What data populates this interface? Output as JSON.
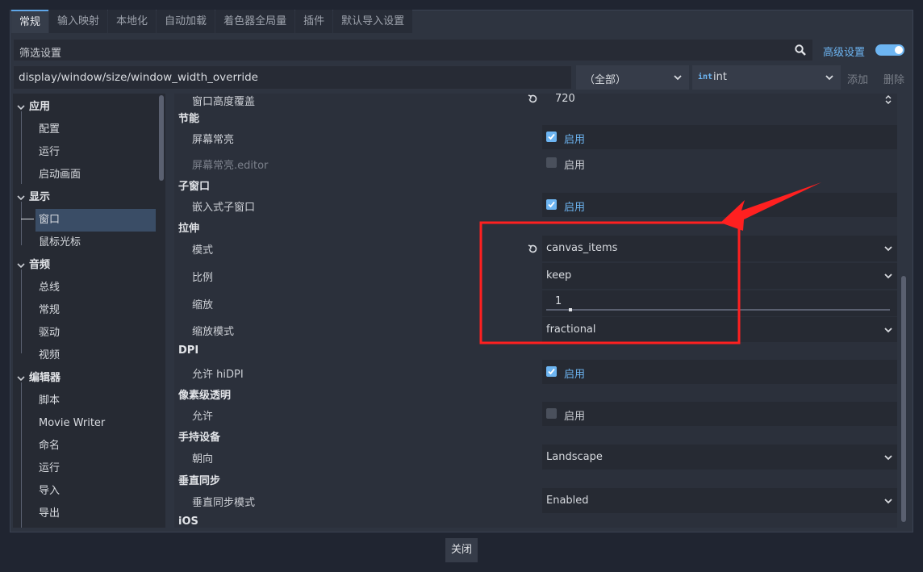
{
  "tabs": [
    "常规",
    "输入映射",
    "本地化",
    "自动加载",
    "着色器全局量",
    "插件",
    "默认导入设置"
  ],
  "filter": {
    "placeholder": "筛选设置"
  },
  "advanced": {
    "label": "高级设置",
    "enabled": true
  },
  "path": {
    "value": "display/window/size/window_width_override"
  },
  "category_dropdown": {
    "selected": "（全部）"
  },
  "type_dropdown": {
    "icon": "int",
    "selected": "int"
  },
  "buttons": {
    "add": "添加",
    "delete": "删除",
    "close": "关闭"
  },
  "sidebar": {
    "items": [
      {
        "label": "应用",
        "type": "category"
      },
      {
        "label": "配置",
        "type": "item"
      },
      {
        "label": "运行",
        "type": "item"
      },
      {
        "label": "启动画面",
        "type": "item"
      },
      {
        "label": "显示",
        "type": "category"
      },
      {
        "label": "窗口",
        "type": "item",
        "selected": true
      },
      {
        "label": "鼠标光标",
        "type": "item"
      },
      {
        "label": "音频",
        "type": "category"
      },
      {
        "label": "总线",
        "type": "item"
      },
      {
        "label": "常规",
        "type": "item"
      },
      {
        "label": "驱动",
        "type": "item"
      },
      {
        "label": "视频",
        "type": "item"
      },
      {
        "label": "编辑器",
        "type": "category"
      },
      {
        "label": "脚本",
        "type": "item"
      },
      {
        "label": "Movie Writer",
        "type": "item"
      },
      {
        "label": "命名",
        "type": "item"
      },
      {
        "label": "运行",
        "type": "item"
      },
      {
        "label": "导入",
        "type": "item"
      },
      {
        "label": "导出",
        "type": "item"
      }
    ]
  },
  "main": {
    "partial_top": {
      "name": "窗口高度覆盖",
      "value": "720"
    },
    "sections": [
      {
        "title": "节能",
        "props": [
          {
            "name": "屏幕常亮",
            "kind": "checkbox",
            "checked": true,
            "label": "启用"
          },
          {
            "name": "屏幕常亮.editor",
            "kind": "checkbox",
            "checked": false,
            "label": "启用",
            "dim": true
          }
        ]
      },
      {
        "title": "子窗口",
        "props": [
          {
            "name": "嵌入式子窗口",
            "kind": "checkbox",
            "checked": true,
            "label": "启用"
          }
        ]
      },
      {
        "title": "拉伸",
        "props": [
          {
            "name": "模式",
            "kind": "dropdown",
            "value": "canvas_items",
            "reset": true
          },
          {
            "name": "比例",
            "kind": "dropdown",
            "value": "keep"
          },
          {
            "name": "缩放",
            "kind": "slider",
            "value": "1",
            "level": 0.07
          },
          {
            "name": "缩放模式",
            "kind": "dropdown",
            "value": "fractional"
          }
        ]
      },
      {
        "title": "DPI",
        "props": [
          {
            "name": "允许 hiDPI",
            "kind": "checkbox",
            "checked": true,
            "label": "启用"
          }
        ]
      },
      {
        "title": "像素级透明",
        "props": [
          {
            "name": "允许",
            "kind": "checkbox",
            "checked": false,
            "label": "启用"
          }
        ]
      },
      {
        "title": "手持设备",
        "props": [
          {
            "name": "朝向",
            "kind": "dropdown",
            "value": "Landscape"
          }
        ]
      },
      {
        "title": "垂直同步",
        "props": [
          {
            "name": "垂直同步模式",
            "kind": "dropdown",
            "value": "Enabled"
          }
        ]
      },
      {
        "title": "iOS",
        "props": []
      }
    ]
  },
  "colors": {
    "accent": "#6db5f2",
    "annotation": "#ff2020"
  }
}
